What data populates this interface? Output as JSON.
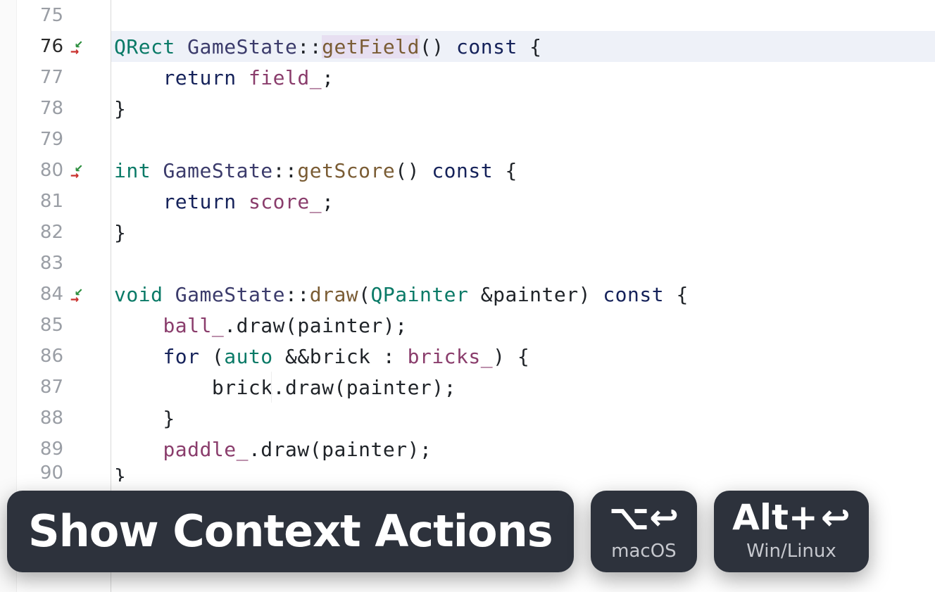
{
  "active_line": 76,
  "lines": [
    {
      "num": 75,
      "merge": false,
      "tokens": []
    },
    {
      "num": 76,
      "merge": true,
      "tokens": [
        {
          "t": "QRect",
          "c": "t-type"
        },
        {
          "t": " ",
          "c": "t-plain"
        },
        {
          "t": "GameState",
          "c": "t-class"
        },
        {
          "t": "::",
          "c": "t-plain"
        },
        {
          "t": "getField",
          "c": "t-func",
          "hl": true
        },
        {
          "t": "()",
          "c": "t-plain"
        },
        {
          "t": " ",
          "c": "t-plain"
        },
        {
          "t": "const",
          "c": "t-kw"
        },
        {
          "t": " {",
          "c": "t-punct"
        }
      ]
    },
    {
      "num": 77,
      "merge": false,
      "tokens": [
        {
          "t": "    ",
          "c": "t-plain"
        },
        {
          "t": "return",
          "c": "t-kw"
        },
        {
          "t": " ",
          "c": "t-plain"
        },
        {
          "t": "field_",
          "c": "t-memb"
        },
        {
          "t": ";",
          "c": "t-punct"
        }
      ]
    },
    {
      "num": 78,
      "merge": false,
      "tokens": [
        {
          "t": "}",
          "c": "t-punct"
        }
      ]
    },
    {
      "num": 79,
      "merge": false,
      "tokens": []
    },
    {
      "num": 80,
      "merge": true,
      "tokens": [
        {
          "t": "int",
          "c": "t-type"
        },
        {
          "t": " ",
          "c": "t-plain"
        },
        {
          "t": "GameState",
          "c": "t-class"
        },
        {
          "t": "::",
          "c": "t-plain"
        },
        {
          "t": "getScore",
          "c": "t-func"
        },
        {
          "t": "()",
          "c": "t-plain"
        },
        {
          "t": " ",
          "c": "t-plain"
        },
        {
          "t": "const",
          "c": "t-kw"
        },
        {
          "t": " {",
          "c": "t-punct"
        }
      ]
    },
    {
      "num": 81,
      "merge": false,
      "tokens": [
        {
          "t": "    ",
          "c": "t-plain"
        },
        {
          "t": "return",
          "c": "t-kw"
        },
        {
          "t": " ",
          "c": "t-plain"
        },
        {
          "t": "score_",
          "c": "t-memb"
        },
        {
          "t": ";",
          "c": "t-punct"
        }
      ]
    },
    {
      "num": 82,
      "merge": false,
      "tokens": [
        {
          "t": "}",
          "c": "t-punct"
        }
      ]
    },
    {
      "num": 83,
      "merge": false,
      "tokens": []
    },
    {
      "num": 84,
      "merge": true,
      "tokens": [
        {
          "t": "void",
          "c": "t-type"
        },
        {
          "t": " ",
          "c": "t-plain"
        },
        {
          "t": "GameState",
          "c": "t-class"
        },
        {
          "t": "::",
          "c": "t-plain"
        },
        {
          "t": "draw",
          "c": "t-func"
        },
        {
          "t": "(",
          "c": "t-punct"
        },
        {
          "t": "QPainter",
          "c": "t-type"
        },
        {
          "t": " &painter)",
          "c": "t-plain"
        },
        {
          "t": " ",
          "c": "t-plain"
        },
        {
          "t": "const",
          "c": "t-kw"
        },
        {
          "t": " {",
          "c": "t-punct"
        }
      ]
    },
    {
      "num": 85,
      "merge": false,
      "tokens": [
        {
          "t": "    ",
          "c": "t-plain"
        },
        {
          "t": "ball_",
          "c": "t-memb"
        },
        {
          "t": ".draw(painter);",
          "c": "t-plain"
        }
      ]
    },
    {
      "num": 86,
      "merge": false,
      "tokens": [
        {
          "t": "    ",
          "c": "t-plain"
        },
        {
          "t": "for",
          "c": "t-kw"
        },
        {
          "t": " (",
          "c": "t-plain"
        },
        {
          "t": "auto",
          "c": "t-type"
        },
        {
          "t": " &&brick : ",
          "c": "t-plain"
        },
        {
          "t": "bricks_",
          "c": "t-memb"
        },
        {
          "t": ") {",
          "c": "t-punct"
        }
      ]
    },
    {
      "num": 87,
      "merge": false,
      "tokens": [
        {
          "t": "        brick.draw(painter);",
          "c": "t-plain"
        }
      ]
    },
    {
      "num": 88,
      "merge": false,
      "tokens": [
        {
          "t": "    }",
          "c": "t-punct"
        }
      ]
    },
    {
      "num": 89,
      "merge": false,
      "tokens": [
        {
          "t": "    ",
          "c": "t-plain"
        },
        {
          "t": "paddle_",
          "c": "t-memb"
        },
        {
          "t": ".draw(painter);",
          "c": "t-plain"
        }
      ]
    },
    {
      "num": 90,
      "merge": false,
      "tokens": [
        {
          "t": "}",
          "c": "t-punct"
        }
      ],
      "truncated": true
    }
  ],
  "overlay": {
    "title": "Show Context Actions",
    "mac": {
      "glyphs": "⌥↩",
      "sub": "macOS"
    },
    "win": {
      "label_prefix": "Alt+",
      "glyph": "↩",
      "sub": "Win/Linux"
    }
  }
}
